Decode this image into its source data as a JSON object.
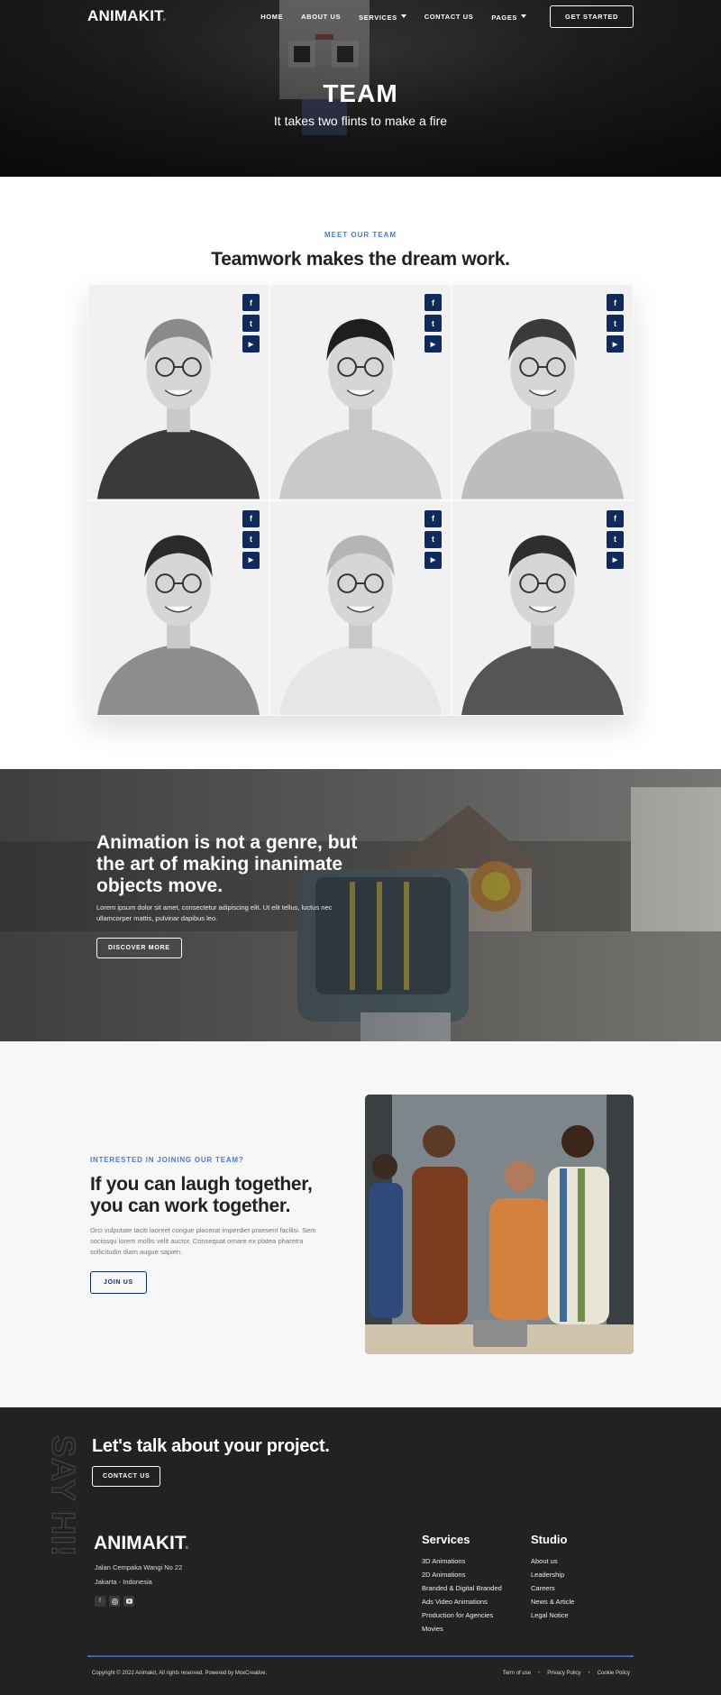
{
  "brand": {
    "name": "ANIMAKIT",
    "dot": ".",
    "accent": "#4a7bd0",
    "navy": "#0f2a5c",
    "footer_bg": "#222222"
  },
  "nav": {
    "items": [
      {
        "label": "HOME",
        "dropdown": false
      },
      {
        "label": "ABOUT US",
        "dropdown": false
      },
      {
        "label": "SERVICES",
        "dropdown": true
      },
      {
        "label": "CONTACT US",
        "dropdown": false
      },
      {
        "label": "PAGES",
        "dropdown": true
      }
    ],
    "cta": "GET STARTED"
  },
  "hero": {
    "title": "TEAM",
    "subtitle": "It takes two flints to make a fire"
  },
  "team": {
    "eyebrow": "MEET OUR TEAM",
    "heading": "Teamwork makes the dream work.",
    "social_icons": [
      "facebook-icon",
      "twitter-icon",
      "youtube-icon"
    ]
  },
  "banner": {
    "title": "Animation is not a genre, but the art of making inanimate objects move.",
    "text": "Lorem ipsum dolor sit amet, consectetur adipiscing elit. Ut elit tellus, luctus nec ullamcorper mattis, pulvinar dapibus leo.",
    "button": "DISCOVER MORE"
  },
  "join": {
    "eyebrow": "INTERESTED IN JOINING OUR TEAM?",
    "title": "If you can laugh together, you can work together.",
    "text": "Orci vulputate taciti laoreet congue placerat imperdiet praesent facilisi. Sem sociosqu lorem mollis velit auctor. Consequat ornare ex platea pharetra sollicitudin diam augue sapien.",
    "button": "JOIN US"
  },
  "footer": {
    "say_hi": "SAY HI!",
    "cta_title": "Let's talk about your project.",
    "cta_button": "CONTACT US",
    "address_line1": "Jalan Cempaka Wangi No 22",
    "address_line2": "Jakarta - Indonesia",
    "socials": [
      "facebook-icon",
      "instagram-icon",
      "youtube-icon"
    ],
    "services": {
      "title": "Services",
      "items": [
        "3D Animations",
        "2D Animations",
        "Branded & Digital Branded",
        "Ads Video Animations",
        "Production for Agencies",
        "Movies"
      ]
    },
    "studio": {
      "title": "Studio",
      "items": [
        "About us",
        "Leadership",
        "Careers",
        "News & Article",
        "Legal Notice"
      ]
    },
    "copyright": "Copyright © 2022 Animakit, All rights reserved. Powered by MoxCreative.",
    "legal": [
      "Term of use",
      "Privacy Policy",
      "Cookie Policy"
    ],
    "legal_separator": "•"
  }
}
